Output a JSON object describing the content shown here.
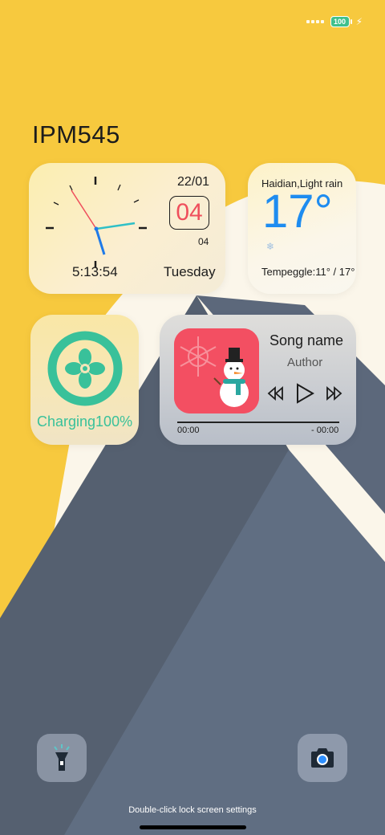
{
  "status": {
    "battery": "100",
    "bolt": "⚡"
  },
  "title": "IPM545",
  "clock": {
    "date": "22/01",
    "day_box": "04",
    "small_day": "04",
    "time": "5:13:54",
    "weekday": "Tuesday"
  },
  "weather": {
    "location": "Haidian,Light rain",
    "temp": "17°",
    "icon": "❄",
    "range": "Tempeggle:11° / 17°"
  },
  "charging": {
    "label": "Charging100%",
    "icon": "fan-icon",
    "color": "#39c19a"
  },
  "music": {
    "song": "Song name",
    "author": "Author",
    "elapsed": "00:00",
    "remaining": "- 00:00"
  },
  "footer": {
    "hint": "Double-click lock screen settings"
  }
}
